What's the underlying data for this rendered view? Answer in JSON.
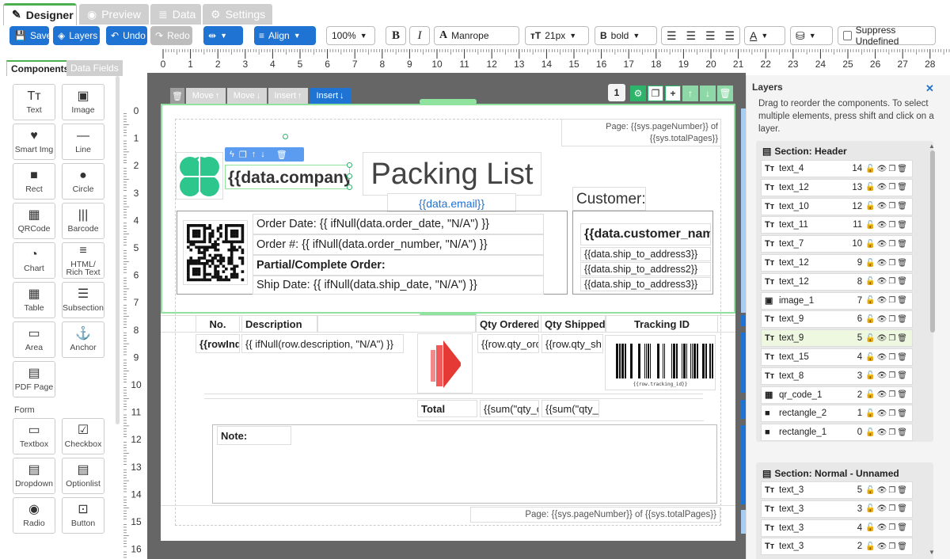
{
  "tabs": [
    {
      "label": "Designer",
      "active": true
    },
    {
      "label": "Preview"
    },
    {
      "label": "Data"
    },
    {
      "label": "Settings"
    }
  ],
  "toolbar": {
    "save": "Save",
    "layers": "Layers",
    "undo": "Undo",
    "redo": "Redo",
    "align": "Align",
    "zoom": "100%",
    "bold": "B",
    "italic": "I",
    "font_prefix": "A",
    "font": "Manrope",
    "size_prefix": "тT",
    "size": "21px",
    "weight_prefix": "B",
    "weight": "bold",
    "color_prefix": "A",
    "suppress": "Suppress Undefined"
  },
  "ruler": {
    "top": [
      "0",
      "1",
      "2",
      "3",
      "4",
      "5",
      "6",
      "7",
      "8",
      "9",
      "10",
      "11",
      "12",
      "13",
      "14",
      "15",
      "16",
      "17",
      "18",
      "19",
      "20",
      "21",
      "22",
      "23",
      "24",
      "25",
      "26",
      "27",
      "28"
    ],
    "left": [
      "0",
      "1",
      "2",
      "3",
      "4",
      "5",
      "6",
      "7",
      "8",
      "9",
      "10",
      "11",
      "12",
      "13",
      "14",
      "15",
      "16"
    ]
  },
  "left": {
    "tab_components": "Components",
    "tab_datafields": "Data Fields",
    "form_heading": "Form",
    "components": [
      {
        "label": "Text",
        "icon": "Tт"
      },
      {
        "label": "Image",
        "icon": "▣"
      },
      {
        "label": "Smart Img",
        "icon": "♥"
      },
      {
        "label": "Line",
        "icon": "—"
      },
      {
        "label": "Rect",
        "icon": "■"
      },
      {
        "label": "Circle",
        "icon": "●"
      },
      {
        "label": "QRCode",
        "icon": "▦"
      },
      {
        "label": "Barcode",
        "icon": "|||"
      },
      {
        "label": "Chart",
        "icon": "◔"
      },
      {
        "label": "HTML/ Rich Text",
        "icon": "≡"
      },
      {
        "label": "Table",
        "icon": "▦"
      },
      {
        "label": "Subsection",
        "icon": "☰"
      },
      {
        "label": "Area",
        "icon": "▭"
      },
      {
        "label": "Anchor",
        "icon": "⚓"
      },
      {
        "label": "PDF Page",
        "icon": "▤"
      }
    ],
    "form": [
      {
        "label": "Textbox",
        "icon": "▭"
      },
      {
        "label": "Checkbox",
        "icon": "☑"
      },
      {
        "label": "Dropdown",
        "icon": "▤"
      },
      {
        "label": "Optionlist",
        "icon": "▤"
      },
      {
        "label": "Radio",
        "icon": "◉"
      },
      {
        "label": "Button",
        "icon": "⊡"
      }
    ]
  },
  "section_bar": {
    "move_up": "Move",
    "move_down": "Move",
    "insert_up": "Insert",
    "insert_down": "Insert",
    "page_num": "1"
  },
  "report": {
    "page_header": "Page: {{sys.pageNumber}} of {{sys.totalPages}}",
    "company": "{{data.company",
    "title": "Packing List",
    "email": "{{data.email}}",
    "customer_label": "Customer:",
    "customer_name": "{{data.customer_name}}",
    "addr3": "{{data.ship_to_address3}}",
    "addr2": "{{data.ship_to_address2}}",
    "addr1": "{{data.ship_to_address3}}",
    "order_date": "Order Date: {{ ifNull(data.order_date, \"N/A\") }}",
    "order_no": "Order #: {{ ifNull(data.order_number, \"N/A\") }}",
    "partial": "Partial/Complete Order:",
    "ship_date": "Ship Date: {{ ifNull(data.ship_date, \"N/A\") }}",
    "col_no": "No.",
    "col_desc": "Description",
    "col_qty_ord": "Qty Ordered",
    "col_qty_ship": "Qty Shipped",
    "col_track": "Tracking ID",
    "row_index": "{{rowInd",
    "row_desc": "{{ ifNull(row.description, \"N/A\") }}",
    "row_qty_ord": "{{row.qty_orc",
    "row_qty_ship": "{{row.qty_sh",
    "barcode_caption": "{{row.tracking_id}}",
    "total": "Total",
    "sum_ord": "{{sum(\"qty_c",
    "sum_ship": "{{sum(\"qty_s",
    "note": "Note:",
    "page_footer": "Page: {{sys.pageNumber}} of {{sys.totalPages}}"
  },
  "layers": {
    "title": "Layers",
    "hint": "Drag to reorder the components. To select multiple elements, press shift and click on a layer.",
    "section1": "Section: Header",
    "items1": [
      {
        "icon": "Tт",
        "name": "text_4",
        "n": "14"
      },
      {
        "icon": "Tт",
        "name": "text_12",
        "n": "13"
      },
      {
        "icon": "Tт",
        "name": "text_10",
        "n": "12"
      },
      {
        "icon": "Tт",
        "name": "text_11",
        "n": "11"
      },
      {
        "icon": "Tт",
        "name": "text_7",
        "n": "10"
      },
      {
        "icon": "Tт",
        "name": "text_12",
        "n": "9"
      },
      {
        "icon": "Tт",
        "name": "text_12",
        "n": "8"
      },
      {
        "icon": "▣",
        "name": "image_1",
        "n": "7"
      },
      {
        "icon": "Tт",
        "name": "text_9",
        "n": "6"
      },
      {
        "icon": "Tт",
        "name": "text_9",
        "n": "5",
        "selected": true
      },
      {
        "icon": "Tт",
        "name": "text_15",
        "n": "4"
      },
      {
        "icon": "Tт",
        "name": "text_8",
        "n": "3"
      },
      {
        "icon": "▦",
        "name": "qr_code_1",
        "n": "2"
      },
      {
        "icon": "■",
        "name": "rectangle_2",
        "n": "1"
      },
      {
        "icon": "■",
        "name": "rectangle_1",
        "n": "0"
      }
    ],
    "section2": "Section: Normal - Unnamed",
    "items2": [
      {
        "icon": "Tт",
        "name": "text_3",
        "n": "5"
      },
      {
        "icon": "Tт",
        "name": "text_3",
        "n": "3"
      },
      {
        "icon": "Tт",
        "name": "text_3",
        "n": "4"
      },
      {
        "icon": "Tт",
        "name": "text_3",
        "n": "2"
      }
    ]
  }
}
